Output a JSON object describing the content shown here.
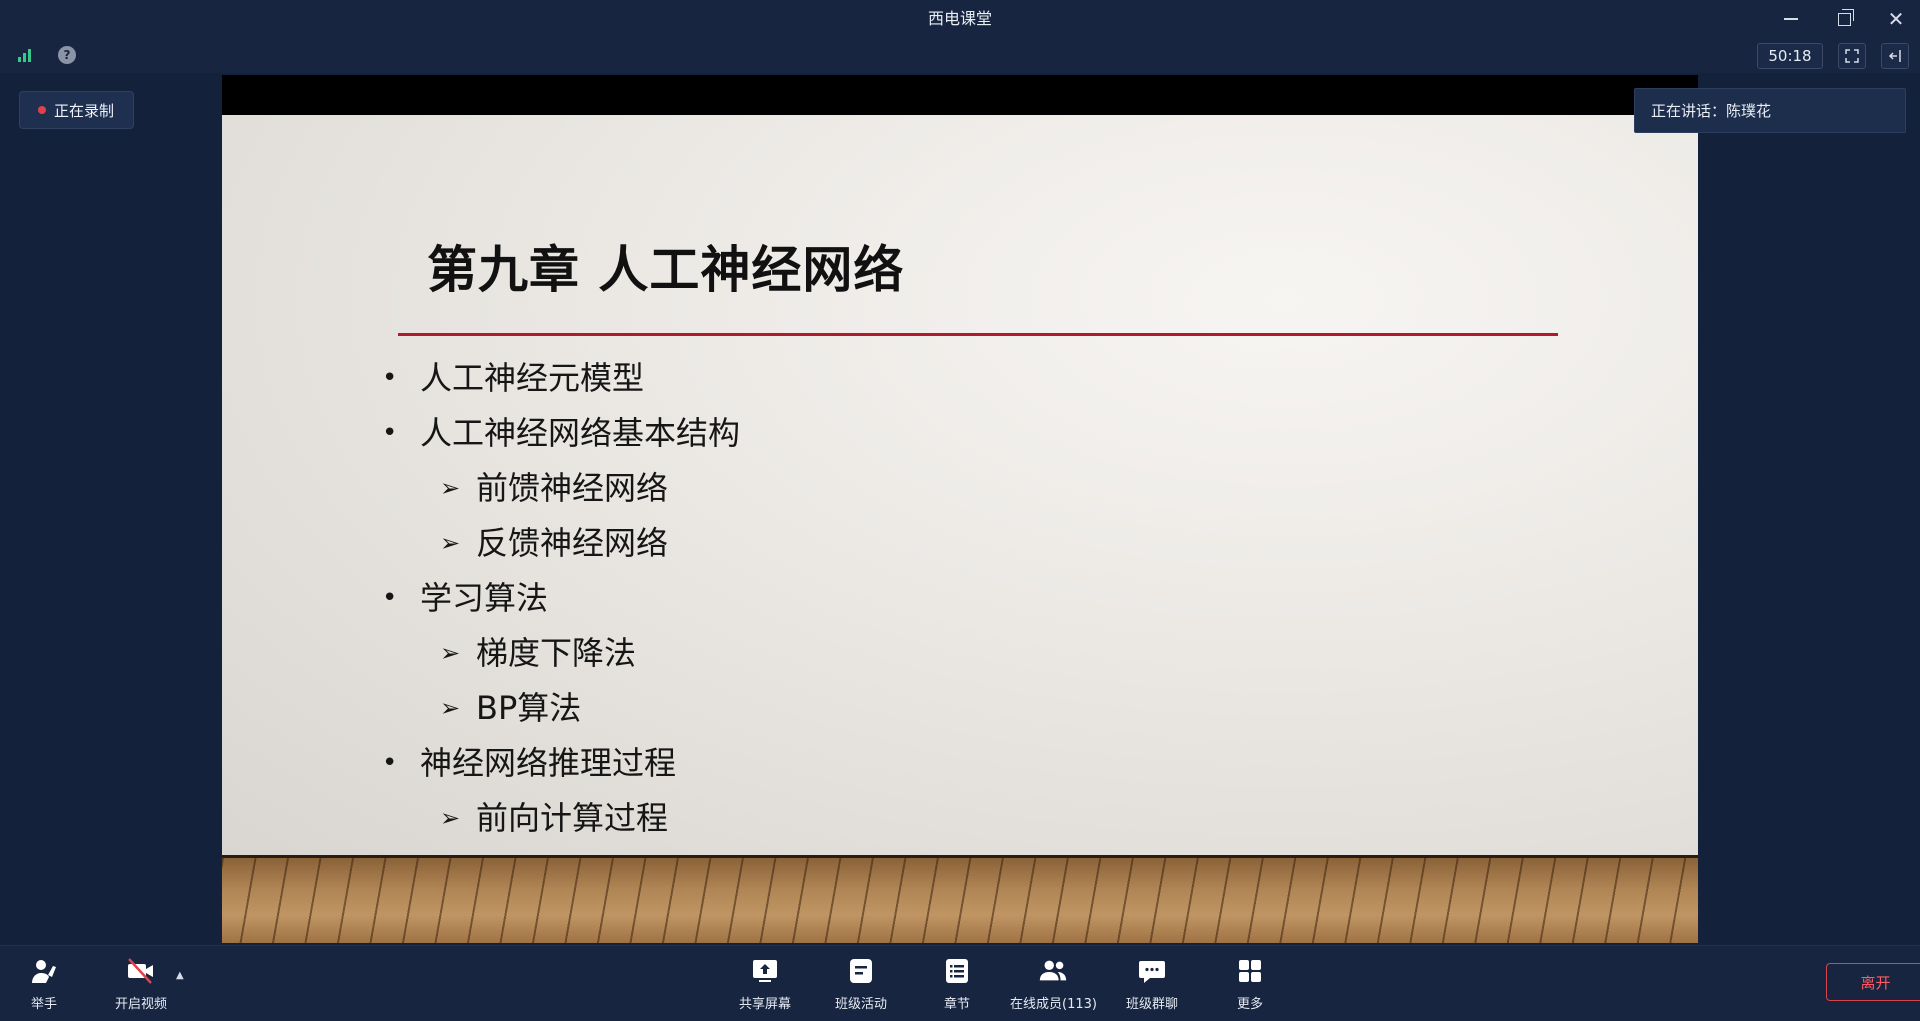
{
  "window": {
    "title": "西电课堂"
  },
  "toolbar": {
    "timer": "50:18"
  },
  "recording": {
    "label": "正在录制"
  },
  "speaker": {
    "label": "正在讲话：陈璞花"
  },
  "slide": {
    "title": "第九章  人工神经网络",
    "items": [
      {
        "level": 1,
        "text": "人工神经元模型"
      },
      {
        "level": 1,
        "text": "人工神经网络基本结构"
      },
      {
        "level": 2,
        "text": "前馈神经网络"
      },
      {
        "level": 2,
        "text": "反馈神经网络"
      },
      {
        "level": 1,
        "text": "学习算法"
      },
      {
        "level": 2,
        "text": "梯度下降法"
      },
      {
        "level": 2,
        "text": "BP算法"
      },
      {
        "level": 1,
        "text": "神经网络推理过程"
      },
      {
        "level": 2,
        "text": "前向计算过程"
      }
    ]
  },
  "bottom": {
    "raise_hand": "举手",
    "video": "开启视频",
    "share_screen": "共享屏幕",
    "class_activity": "班级活动",
    "chapters": "章节",
    "members": "在线成员(113)",
    "group_chat": "班级群聊",
    "more": "更多",
    "leave": "离开"
  },
  "icons": {
    "signal": "signal-strength-icon",
    "help": "help-icon",
    "fullscreen": "fullscreen-icon",
    "collapse": "collapse-panel-icon"
  },
  "colors": {
    "accent_red": "#b01a2b",
    "recording_dot": "#e0414b",
    "signal_green": "#34c88a",
    "leave_red": "#ff5a63"
  }
}
